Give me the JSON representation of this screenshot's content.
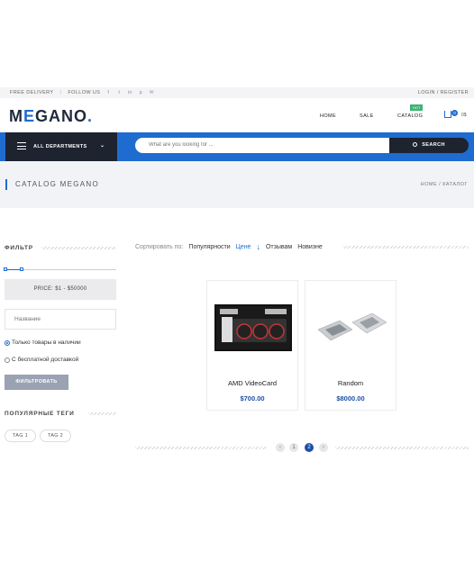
{
  "topbar": {
    "free_delivery": "FREE DELIVERY",
    "follow_us": "FOLLOW US",
    "social_icons": [
      "facebook-icon",
      "twitter-icon",
      "linkedin-icon",
      "pinterest-icon",
      "mail-icon"
    ],
    "account": "LOGIN / REGISTER"
  },
  "header": {
    "logo": {
      "m": "M",
      "e": "E",
      "rest": "GANO",
      "dot": "."
    },
    "nav": {
      "home": "HOME",
      "sale": "SALE",
      "catalog": "CATALOG",
      "hot_badge": "HOT"
    },
    "cart": {
      "count": "0",
      "price": "0$"
    }
  },
  "searchbar": {
    "departments": "ALL DEPARTMENTS",
    "placeholder": "What are you looking for ...",
    "search_button": "SEARCH"
  },
  "banner": {
    "title": "CATALOG MEGANO",
    "breadcrumb": "HOME / КАТАЛОГ"
  },
  "sidebar": {
    "filter_title": "ФИЛЬТР",
    "price_label": "PRICE:  $1 - $50000",
    "name_placeholder": "Название",
    "in_stock": "Только товары в наличии",
    "free_delivery": "С бесплатной доставкой",
    "filter_button": "ФИЛЬТРОВАТЬ",
    "tags_title": "ПОПУЛЯРНЫЕ ТЕГИ",
    "tags": [
      "TAG 1",
      "TAG 2"
    ]
  },
  "sort": {
    "label": "Сортировать по:",
    "options": [
      "Популярности",
      "Цене",
      "Отзывам",
      "Новизне"
    ],
    "active": "Цене"
  },
  "products": [
    {
      "name": "AMD VideoCard",
      "price": "$700.00"
    },
    {
      "name": "Random",
      "price": "$8000.00"
    }
  ],
  "pagination": {
    "pages": [
      "1",
      "2"
    ],
    "current": "2"
  },
  "colors": {
    "accent": "#1f6bd1",
    "dark": "#1e2330",
    "price": "#1e4fa8",
    "hot": "#3cb371"
  }
}
